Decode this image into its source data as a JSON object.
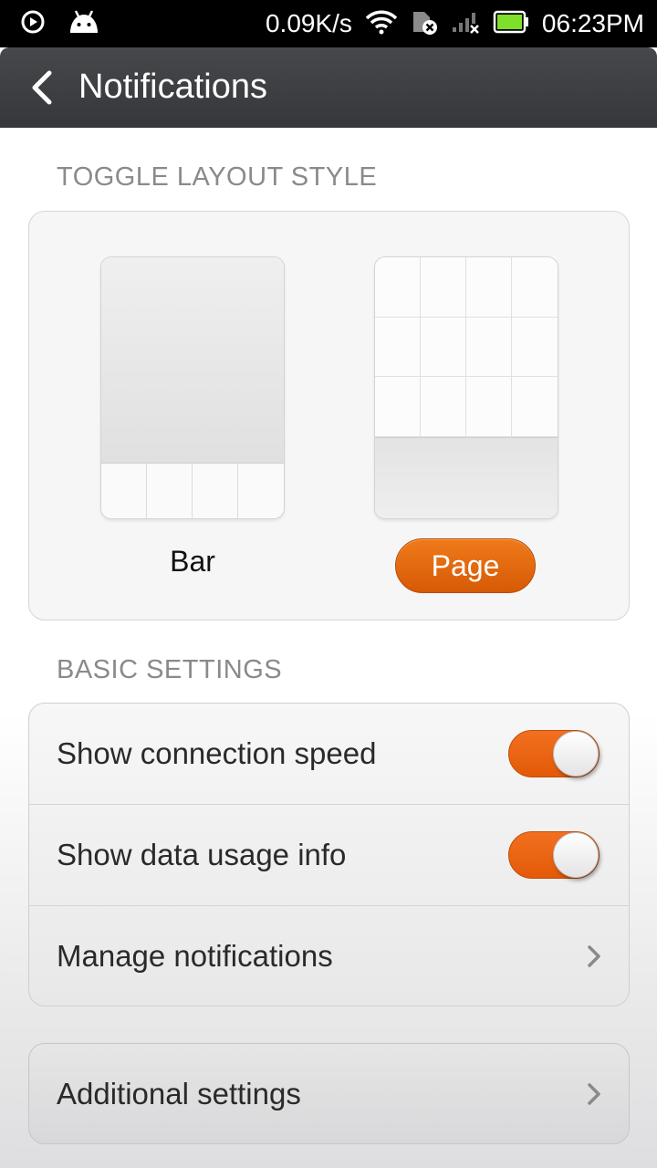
{
  "status_bar": {
    "speed": "0.09K/s",
    "time": "06:23PM",
    "icons": [
      "play-circle-icon",
      "android-icon",
      "wifi-icon",
      "sim-error-icon",
      "no-signal-icon",
      "battery-icon"
    ],
    "battery_color": "#7ee02b"
  },
  "action_bar": {
    "title": "Notifications"
  },
  "toggle_layout": {
    "header": "TOGGLE LAYOUT STYLE",
    "options": [
      {
        "label": "Bar",
        "selected": false
      },
      {
        "label": "Page",
        "selected": true
      }
    ],
    "accent_color": "#e8650f"
  },
  "basic_settings": {
    "header": "BASIC SETTINGS",
    "rows": [
      {
        "label": "Show connection speed",
        "type": "toggle",
        "on": true
      },
      {
        "label": "Show data usage info",
        "type": "toggle",
        "on": true
      },
      {
        "label": "Manage notifications",
        "type": "link"
      }
    ]
  },
  "additional": {
    "label": "Additional settings"
  }
}
